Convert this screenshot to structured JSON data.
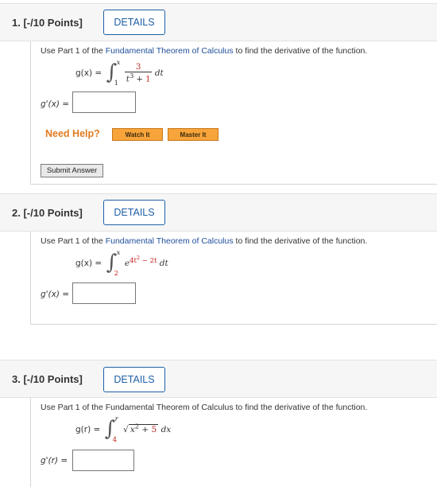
{
  "questions": [
    {
      "title": "1. [-/10 Points]",
      "details": "DETAILS",
      "prompt_before": "Use Part 1 of the ",
      "prompt_link": "Fundamental Theorem of Calculus",
      "prompt_after": " to find the derivative of the function.",
      "func_lhs": "g(x) =",
      "upper": "x",
      "lower": "1",
      "numerator": "3",
      "denominator_a": "t",
      "denominator_exp": "3",
      "denominator_b": " + ",
      "denominator_c": "1",
      "differential": "dt",
      "answer_label": "g'(x) =",
      "answer_value": "",
      "need_help": "Need Help?",
      "watch_it": "Watch It",
      "master_it": "Master It",
      "submit": "Submit Answer"
    },
    {
      "title": "2. [-/10 Points]",
      "details": "DETAILS",
      "prompt_before": "Use Part 1 of the ",
      "prompt_link": "Fundamental Theorem of Calculus",
      "prompt_after": " to find the derivative of the function.",
      "func_lhs": "g(x) =",
      "upper": "x",
      "lower": "2",
      "integrand_base": "e",
      "integrand_exp_a": "4t",
      "integrand_exp_sq": "2",
      "integrand_exp_b": " − 2t",
      "differential": "dt",
      "answer_label": "g'(x) =",
      "answer_value": ""
    },
    {
      "title": "3. [-/10 Points]",
      "details": "DETAILS",
      "prompt_before": "Use Part 1 of the Fundamental Theorem of Calculus to find the derivative of the function.",
      "func_lhs": "g(r) =",
      "upper": "r",
      "lower": "4",
      "radicand_a": "x",
      "radicand_exp": "2",
      "radicand_b": " + ",
      "radicand_c": "5",
      "differential": "dx",
      "answer_label": "g'(r) =",
      "answer_value": ""
    }
  ]
}
